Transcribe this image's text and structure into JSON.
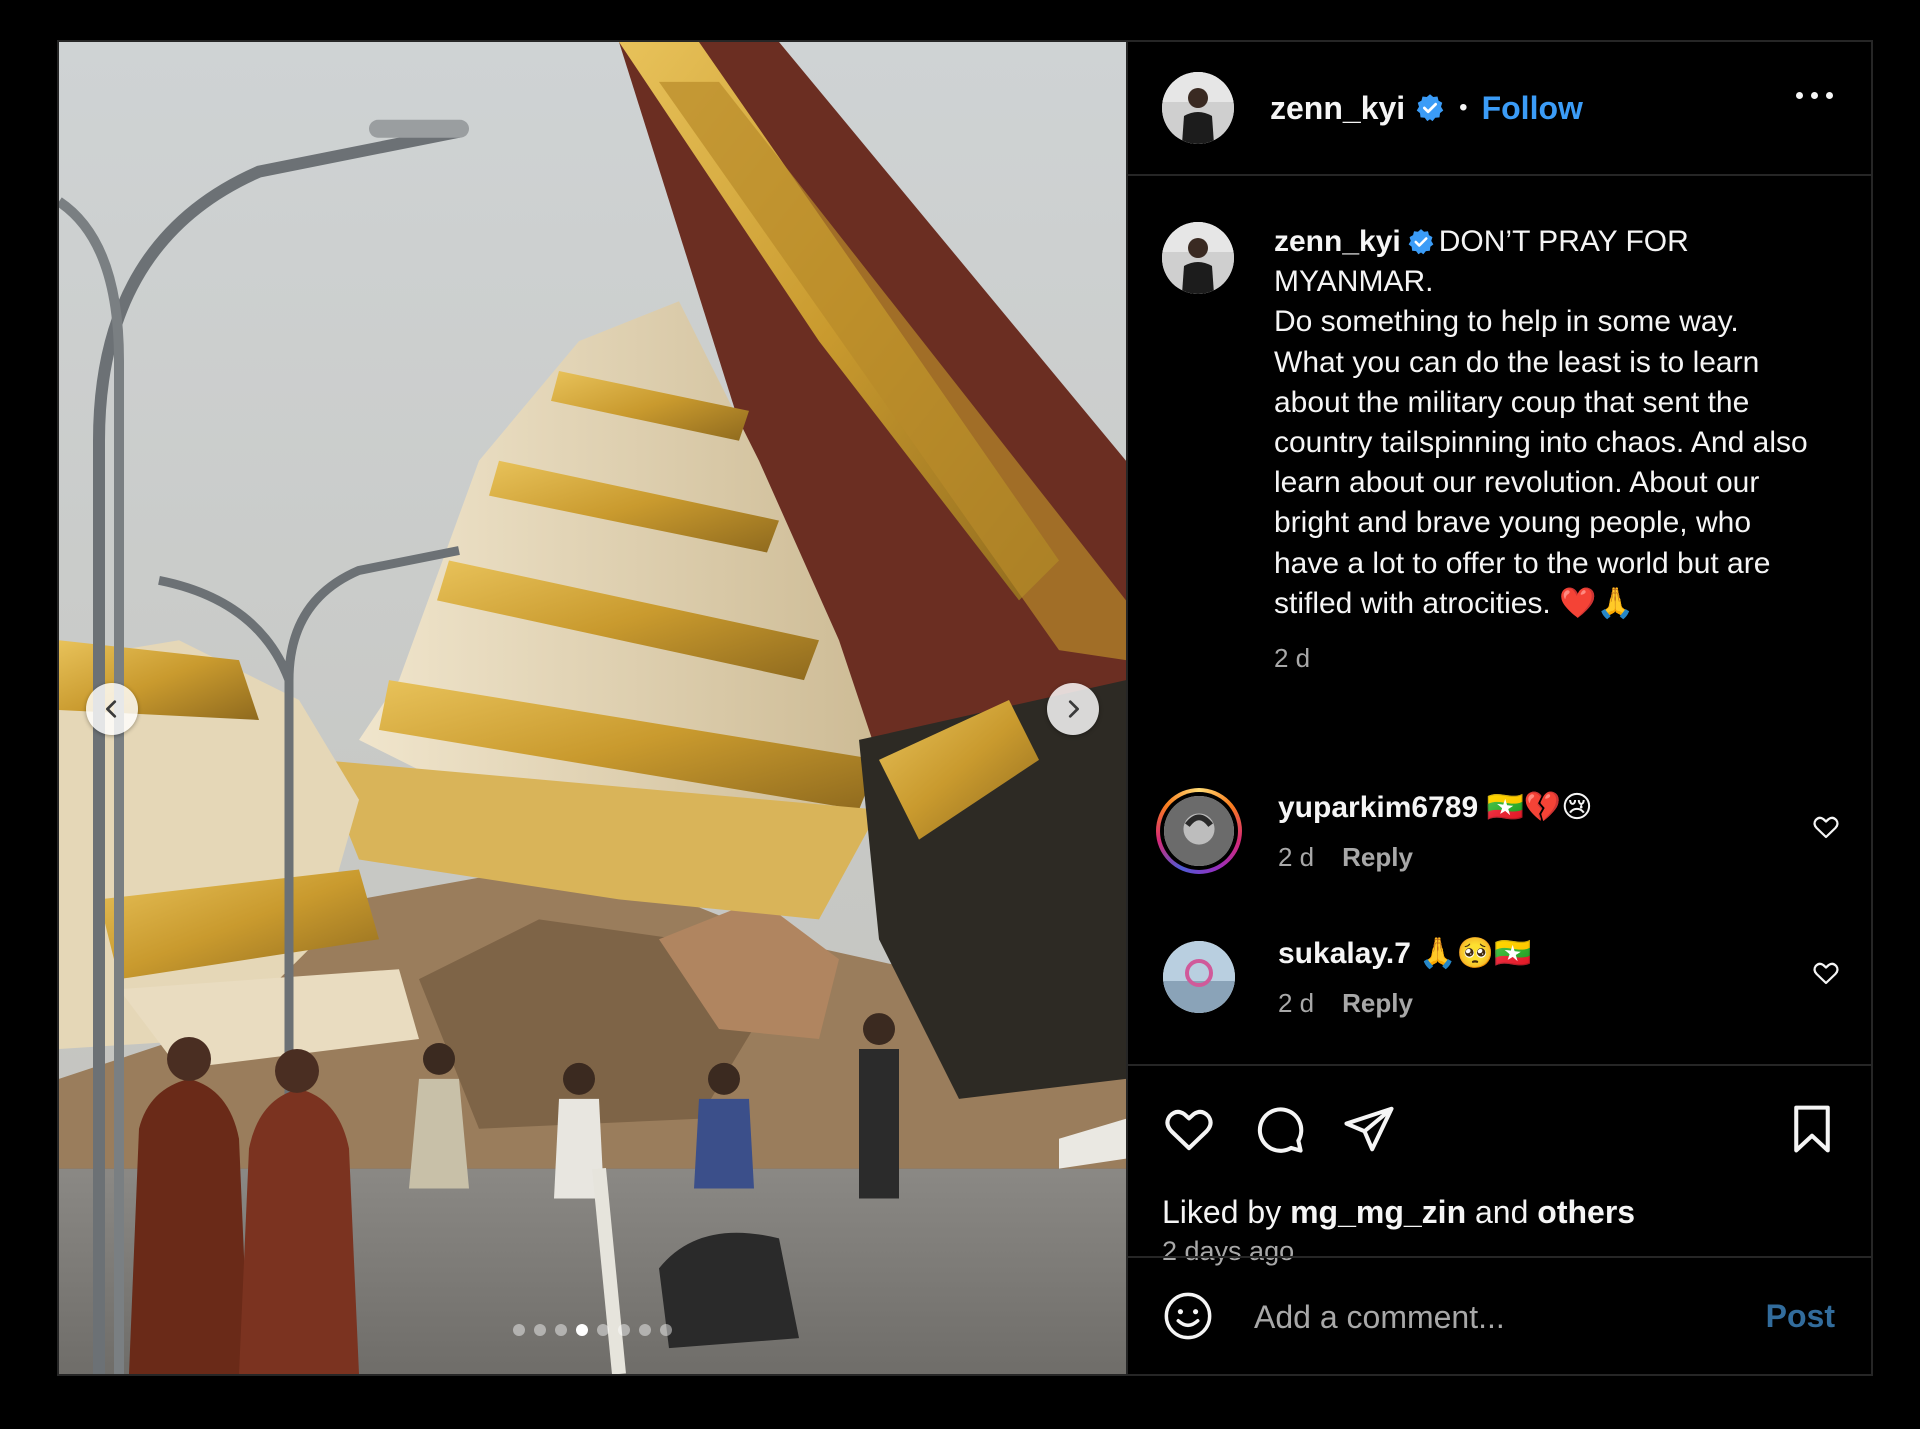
{
  "post": {
    "username": "zenn_kyi",
    "separator": "•",
    "follow_label": "Follow",
    "caption_username": "zenn_kyi",
    "caption_text": "DON’T PRAY FOR MYANMAR.\nDo something to help in some way. What you can do the least is to learn about the military coup that sent the country tailspinning into chaos. And also learn about our revolution. About our bright and brave young people, who have a lot to offer to the world but are stifled with atrocities. ❤️🙏",
    "caption_time": "2 d",
    "carousel": {
      "total_slides": 8,
      "active_slide": 4
    }
  },
  "comments": [
    {
      "username": "yuparkim6789",
      "text": "🇲🇲💔😢",
      "time": "2 d",
      "reply_label": "Reply"
    },
    {
      "username": "sukalay.7",
      "text": "🙏🥺🇲🇲",
      "time": "2 d",
      "reply_label": "Reply"
    }
  ],
  "likes": {
    "prefix": "Liked by",
    "user": "mg_mg_zin",
    "joiner": "and",
    "others": "others"
  },
  "posted_ago": "2 days ago",
  "add_comment": {
    "placeholder": "Add a comment...",
    "post_label": "Post"
  },
  "icons": {
    "verified": "verified-badge-icon",
    "like": "heart-icon",
    "comment": "comment-bubble-icon",
    "share": "paper-plane-icon",
    "save": "bookmark-icon",
    "emoji": "smiley-icon",
    "more": "more-options-icon"
  },
  "colors": {
    "accent": "#3b9cf7",
    "background": "#000000",
    "muted_text": "#a8a8a8",
    "border": "#262626"
  }
}
